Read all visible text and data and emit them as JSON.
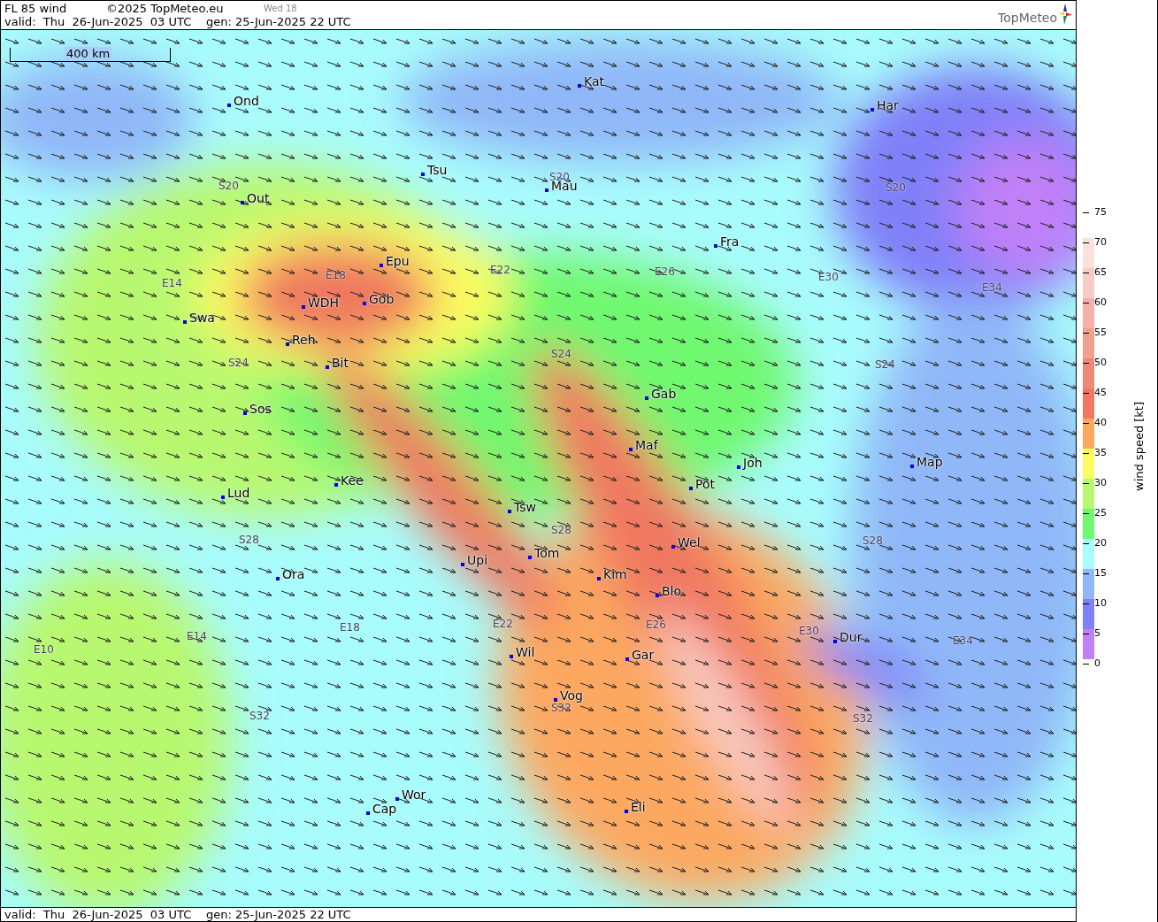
{
  "header": {
    "title": "FL 85 wind",
    "copyright": "©2025 TopMeteo.eu",
    "run_label": "Wed 18",
    "valid": "valid:  Thu  26-Jun-2025  03 UTC",
    "generated": "gen: 25-Jun-2025 22 UTC",
    "logo": "TopMeteo"
  },
  "map": {
    "scale": "400 km",
    "places": [
      "Ond",
      "Kat",
      "Har",
      "Tsu",
      "Mau",
      "Out",
      "Fra",
      "Epu",
      "Gob",
      "WDH",
      "Swa",
      "Reh",
      "Bit",
      "Gab",
      "Sos",
      "Maf",
      "Joh",
      "Map",
      "Pot",
      "Kee",
      "Lud",
      "Tsw",
      "Wel",
      "Upi",
      "Tom",
      "Kim",
      "Ora",
      "Blo",
      "Dur",
      "Wil",
      "Gar",
      "Vog",
      "Wor",
      "Cap",
      "Eli"
    ],
    "grid_labels": [
      "S20",
      "S20",
      "S20",
      "E14",
      "E18",
      "E22",
      "E26",
      "E30",
      "E34",
      "S24",
      "S24",
      "S24",
      "S28",
      "S28",
      "S28",
      "E10",
      "E14",
      "E18",
      "E22",
      "E26",
      "E30",
      "E34",
      "S32",
      "S32",
      "S32"
    ]
  },
  "legend": {
    "title": "wind speed [kt]",
    "ticks": [
      "75",
      "70",
      "65",
      "60",
      "55",
      "50",
      "45",
      "40",
      "35",
      "30",
      "25",
      "20",
      "15",
      "10",
      "5",
      "0"
    ],
    "bands": [
      {
        "color": "#fce0dc"
      },
      {
        "color": "#f8ccc4"
      },
      {
        "color": "#f4b0a8"
      },
      {
        "color": "#f0a090"
      },
      {
        "color": "#f08878"
      },
      {
        "color": "#f07860"
      },
      {
        "color": "#fca860"
      },
      {
        "color": "#fcfc60"
      },
      {
        "color": "#b8f870"
      },
      {
        "color": "#70f870"
      },
      {
        "color": "#a8fcfc"
      },
      {
        "color": "#90b8f8"
      },
      {
        "color": "#8080f8"
      },
      {
        "color": "#c080f8"
      }
    ]
  },
  "footer": {
    "valid": "valid:  Thu  26-Jun-2025  03 UTC",
    "generated": "gen: 25-Jun-2025 22 UTC"
  }
}
